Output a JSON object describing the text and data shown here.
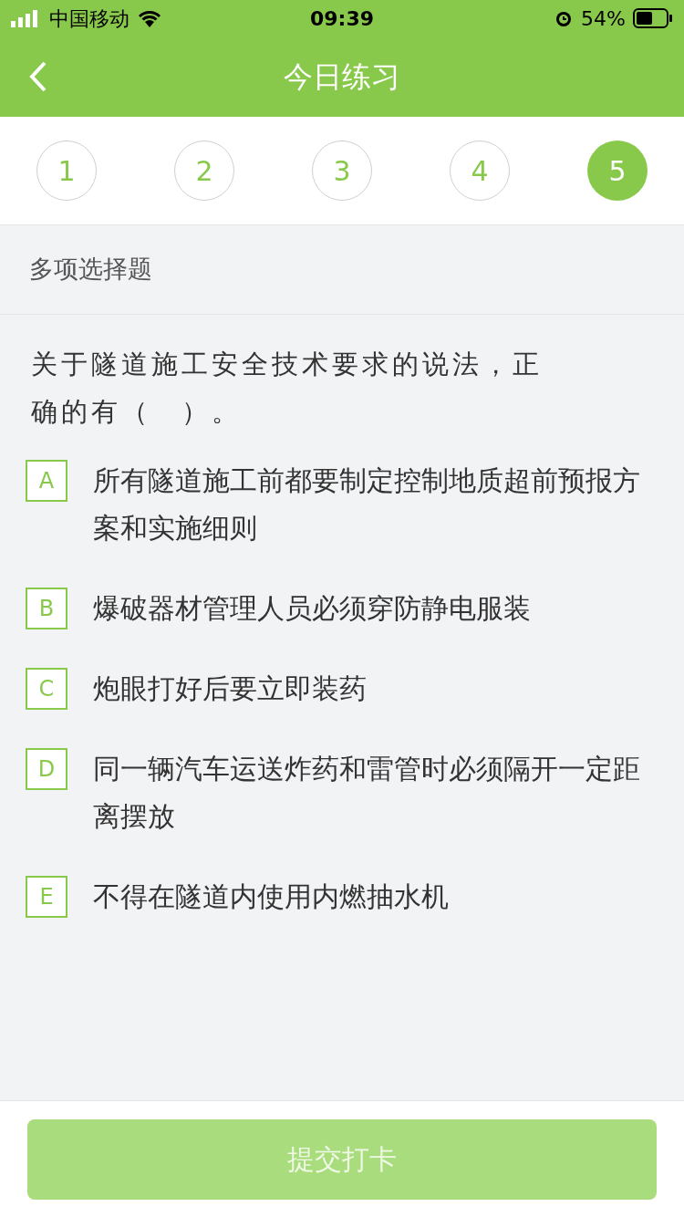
{
  "status_bar": {
    "carrier": "中国移动",
    "time": "09:39",
    "battery": "54%"
  },
  "header": {
    "title": "今日练习"
  },
  "question_tabs": [
    {
      "label": "1",
      "selected": false
    },
    {
      "label": "2",
      "selected": false
    },
    {
      "label": "3",
      "selected": false
    },
    {
      "label": "4",
      "selected": false
    },
    {
      "label": "5",
      "selected": true
    }
  ],
  "question": {
    "type_label": "多项选择题",
    "text": "关于隧道施工安全技术要求的说法，正确的有（　）。",
    "options": [
      {
        "letter": "A",
        "text": "所有隧道施工前都要制定控制地质超前预报方案和实施细则",
        "selected": false
      },
      {
        "letter": "B",
        "text": "爆破器材管理人员必须穿防静电服装",
        "selected": false
      },
      {
        "letter": "C",
        "text": "炮眼打好后要立即装药",
        "selected": false
      },
      {
        "letter": "D",
        "text": "同一辆汽车运送炸药和雷管时必须隔开一定距离摆放",
        "selected": false
      },
      {
        "letter": "E",
        "text": "不得在隧道内使用内燃抽水机",
        "selected": false
      }
    ]
  },
  "submit_button": {
    "label": "提交打卡",
    "disabled": true
  }
}
